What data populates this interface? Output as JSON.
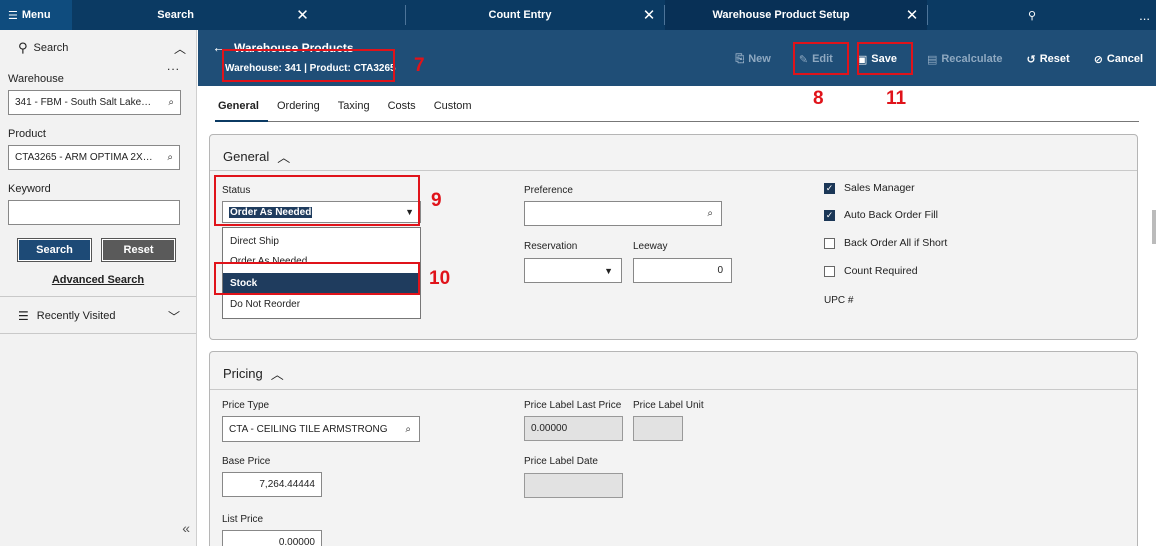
{
  "topbar": {
    "menu_label": "Menu",
    "search_label": "Search",
    "tabs": [
      {
        "label": "Count Entry"
      },
      {
        "label": "Warehouse Product Setup"
      }
    ],
    "more": "..."
  },
  "left": {
    "search_label": "Search",
    "more": "...",
    "warehouse_label": "Warehouse",
    "warehouse_value": "341 - FBM - South Salt Lake…",
    "product_label": "Product",
    "product_value": "CTA3265 - ARM OPTIMA 2X…",
    "keyword_label": "Keyword",
    "keyword_value": "",
    "search_button": "Search",
    "reset_button": "Reset",
    "advanced_search": "Advanced Search",
    "recently_visited": "Recently Visited"
  },
  "header": {
    "title": "Warehouse Products",
    "subtitle": "Warehouse: 341 | Product: CTA3265",
    "actions": {
      "new": "New",
      "edit": "Edit",
      "save": "Save",
      "recalculate": "Recalculate",
      "reset": "Reset",
      "cancel": "Cancel"
    }
  },
  "annotations": {
    "n7": "7",
    "n8": "8",
    "n9": "9",
    "n10": "10",
    "n11": "11"
  },
  "subtabs": [
    "General",
    "Ordering",
    "Taxing",
    "Costs",
    "Custom"
  ],
  "general": {
    "title": "General",
    "status_label": "Status",
    "status_value": "Order As Needed",
    "status_options": [
      "Direct Ship",
      "Order As Needed",
      "Stock",
      "Do Not Reorder"
    ],
    "preference_label": "Preference",
    "preference_value": "",
    "reservation_label": "Reservation",
    "reservation_value": "",
    "leeway_label": "Leeway",
    "leeway_value": "0",
    "checkboxes": [
      {
        "label": "Sales Manager",
        "checked": true
      },
      {
        "label": "Auto Back Order Fill",
        "checked": true
      },
      {
        "label": "Back Order All if Short",
        "checked": false
      },
      {
        "label": "Count Required",
        "checked": false
      }
    ],
    "upc_label": "UPC #"
  },
  "pricing": {
    "title": "Pricing",
    "price_type_label": "Price Type",
    "price_type_value": "CTA - CEILING TILE ARMSTRONG",
    "label_last_price_label": "Price Label Last Price",
    "label_last_price_value": "0.00000",
    "label_unit_label": "Price Label Unit",
    "label_unit_value": "",
    "base_price_label": "Base Price",
    "base_price_value": "7,264.44444",
    "label_date_label": "Price Label Date",
    "label_date_value": "",
    "list_price_label": "List Price",
    "list_price_value": "0.00000"
  }
}
